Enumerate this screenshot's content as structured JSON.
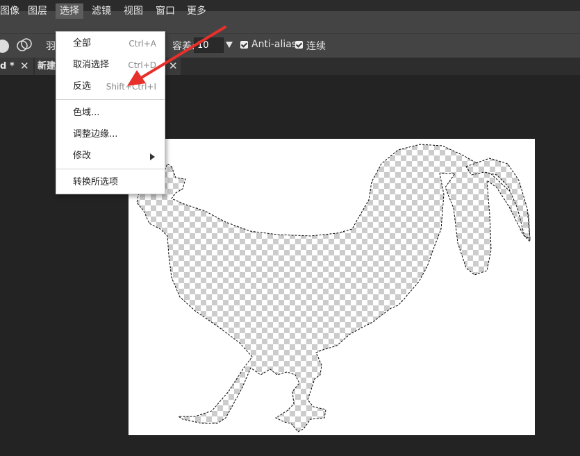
{
  "menubar": {
    "items": [
      {
        "label": "图像"
      },
      {
        "label": "图层"
      },
      {
        "label": "选择"
      },
      {
        "label": "滤镜"
      },
      {
        "label": "视图"
      },
      {
        "label": "窗口"
      },
      {
        "label": "更多"
      }
    ],
    "active": "选择"
  },
  "options": {
    "feather_label": "羽",
    "tolerance_label": "容差:",
    "tolerance_value": "10",
    "antialias_label": "Anti-alias",
    "antialias_checked": true,
    "contiguous_label": "连续",
    "contiguous_checked": true
  },
  "tabs": [
    {
      "label": "d *"
    },
    {
      "label": "新建"
    }
  ],
  "select_menu": {
    "items": [
      {
        "label": "全部",
        "shortcut": "Ctrl+A"
      },
      {
        "label": "取消选择",
        "shortcut": "Ctrl+D"
      },
      {
        "label": "反选",
        "shortcut": "Shift+Ctrl+I"
      },
      {
        "label": "色域..."
      },
      {
        "label": "调整边缘..."
      },
      {
        "label": "修改",
        "submenu": true
      },
      {
        "label": "转换所选项"
      }
    ]
  },
  "colors": {
    "annotation_arrow": "#e8302a",
    "menubar_bg": "#444444",
    "workspace_bg": "#232323"
  },
  "icons": [
    "selection-mode-icon",
    "intersect-mode-icon",
    "close-icon",
    "submenu-arrow-icon",
    "dropdown-arrow-icon",
    "checkbox-icon"
  ]
}
